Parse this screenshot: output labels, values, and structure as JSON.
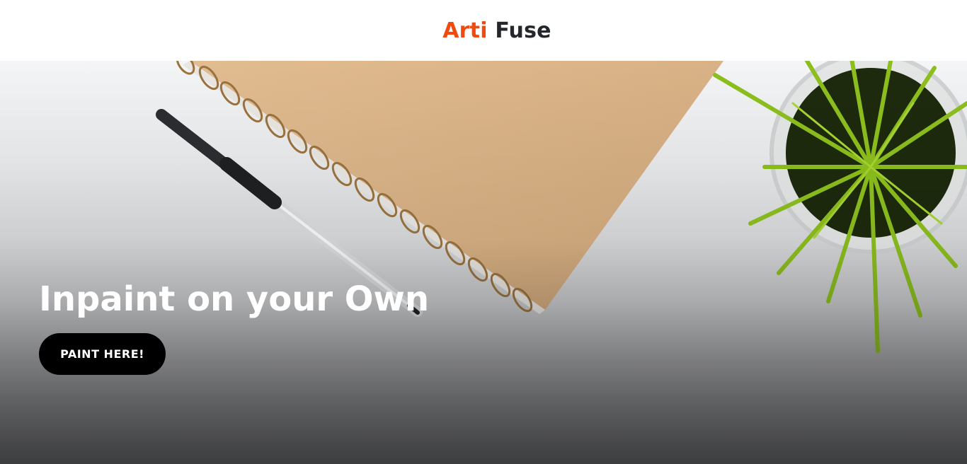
{
  "header": {
    "brand_part1": "Arti",
    "brand_part2": "Fuse"
  },
  "hero": {
    "title": "Inpaint on your Own",
    "cta_label": "PAINT HERE!"
  },
  "colors": {
    "brand_accent": "#f2490f",
    "brand_dark": "#23272b",
    "button_bg": "#000000",
    "button_text": "#ffffff"
  }
}
